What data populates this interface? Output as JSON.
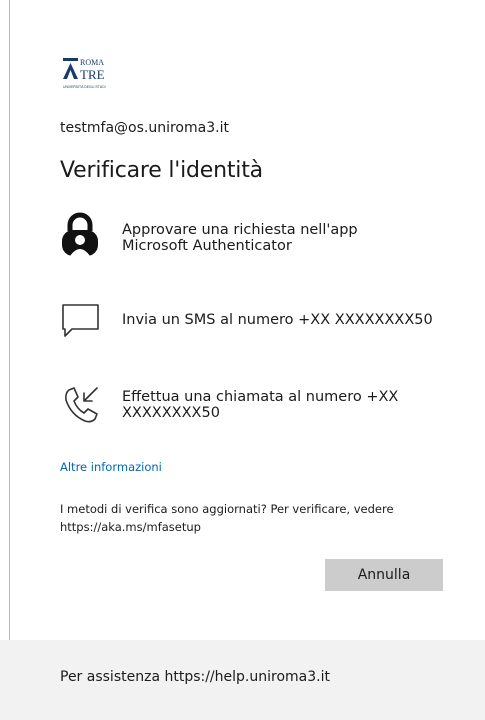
{
  "logo": {
    "line1": "ROMA",
    "line2": "TRE",
    "subtitle": "UNIVERSITÀ DEGLI STUDI"
  },
  "account": {
    "username": "testmfa@os.uniroma3.it"
  },
  "page": {
    "title": "Verificare l'identità"
  },
  "options": [
    {
      "icon": "authenticator-lock-icon",
      "label": "Approvare una richiesta nell'app\nMicrosoft Authenticator"
    },
    {
      "icon": "sms-message-icon",
      "label": "Invia un SMS al numero +XX XXXXXXXX50"
    },
    {
      "icon": "phone-call-icon",
      "label": "Effettua una chiamata al numero +XX\nXXXXXXXX50"
    }
  ],
  "links": {
    "more_info": "Altre informazioni"
  },
  "note": "I metodi di verifica sono aggiornati? Per verificare, vedere\nhttps://aka.ms/mfasetup",
  "buttons": {
    "cancel": "Annulla"
  },
  "footer": {
    "text": "Per assistenza https://help.uniroma3.it"
  },
  "colors": {
    "link": "#0067b8",
    "button_bg": "#cccccc",
    "footer_bg": "#f2f2f2"
  }
}
